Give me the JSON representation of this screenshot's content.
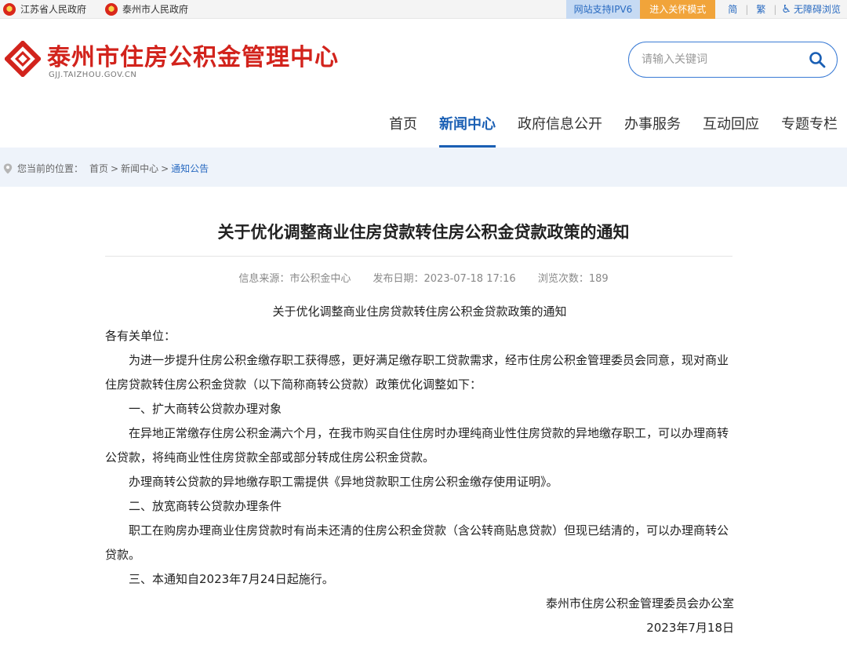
{
  "topbar": {
    "gov1": "江苏省人民政府",
    "gov2": "泰州市人民政府",
    "ipv6": "网站支持IPV6",
    "care_mode": "进入关怀模式",
    "simplified": "简",
    "traditional": "繁",
    "accessible": "无障碍浏览"
  },
  "header": {
    "site_title": "泰州市住房公积金管理中心",
    "site_domain": "GJJ.TAIZHOU.GOV.CN",
    "search_placeholder": "请输入关键词"
  },
  "nav": [
    {
      "label": "首页"
    },
    {
      "label": "新闻中心"
    },
    {
      "label": "政府信息公开"
    },
    {
      "label": "办事服务"
    },
    {
      "label": "互动回应"
    },
    {
      "label": "专题专栏"
    }
  ],
  "breadcrumb": {
    "prefix": "您当前的位置：",
    "items": [
      "首页",
      "新闻中心",
      "通知公告"
    ],
    "arrow": ">"
  },
  "article": {
    "title": "关于优化调整商业住房贷款转住房公积金贷款政策的通知",
    "source": "信息来源：市公积金中心",
    "date": "发布日期：2023-07-18 17:16",
    "views": "浏览次数：189",
    "paragraphs": [
      "关于优化调整商业住房贷款转住房公积金贷款政策的通知",
      "各有关单位：",
      "为进一步提升住房公积金缴存职工获得感，更好满足缴存职工贷款需求，经市住房公积金管理委员会同意，现对商业住房贷款转住房公积金贷款（以下简称商转公贷款）政策优化调整如下：",
      "一、扩大商转公贷款办理对象",
      "在异地正常缴存住房公积金满六个月，在我市购买自住住房时办理纯商业性住房贷款的异地缴存职工，可以办理商转公贷款，将纯商业性住房贷款全部或部分转成住房公积金贷款。",
      "办理商转公贷款的异地缴存职工需提供《异地贷款职工住房公积金缴存使用证明》。",
      "二、放宽商转公贷款办理条件",
      "职工在购房办理商业住房贷款时有尚未还清的住房公积金贷款（含公转商贴息贷款）但现已结清的，可以办理商转公贷款。",
      "三、本通知自2023年7月24日起施行。",
      "泰州市住房公积金管理委员会办公室",
      "2023年7月18日"
    ]
  },
  "colors": {
    "brand_red": "#d2231c",
    "nav_blue": "#1a5fb4",
    "care_orange": "#f1a43a"
  }
}
